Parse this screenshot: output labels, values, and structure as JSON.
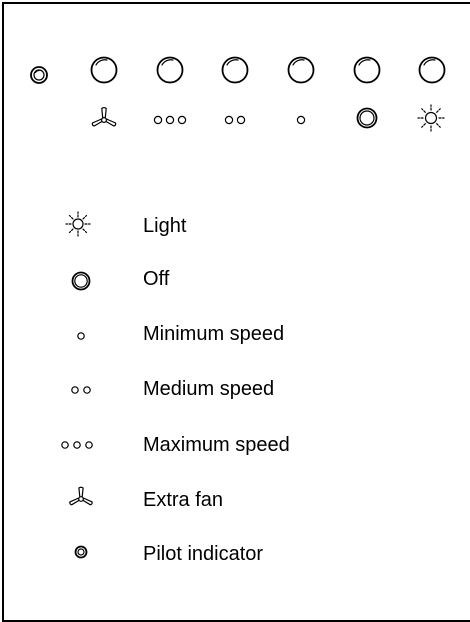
{
  "panel": {
    "pilot": {
      "icon": "pilot-indicator-icon"
    },
    "buttons": [
      {
        "id": "extra-fan",
        "icon": "extra-fan-icon"
      },
      {
        "id": "maximum-speed",
        "icon": "maximum-speed-icon"
      },
      {
        "id": "medium-speed",
        "icon": "medium-speed-icon"
      },
      {
        "id": "minimum-speed",
        "icon": "minimum-speed-icon"
      },
      {
        "id": "off",
        "icon": "off-icon"
      },
      {
        "id": "light",
        "icon": "light-icon"
      }
    ]
  },
  "legend": {
    "items": [
      {
        "icon": "light-icon",
        "label": "Light"
      },
      {
        "icon": "off-icon",
        "label": "Off"
      },
      {
        "icon": "minimum-speed-icon",
        "label": "Minimum speed"
      },
      {
        "icon": "medium-speed-icon",
        "label": "Medium speed"
      },
      {
        "icon": "maximum-speed-icon",
        "label": "Maximum speed"
      },
      {
        "icon": "extra-fan-icon",
        "label": "Extra fan"
      },
      {
        "icon": "pilot-indicator-icon",
        "label": "Pilot indicator"
      }
    ]
  },
  "colors": {
    "line": "#000000",
    "background": "#ffffff"
  }
}
